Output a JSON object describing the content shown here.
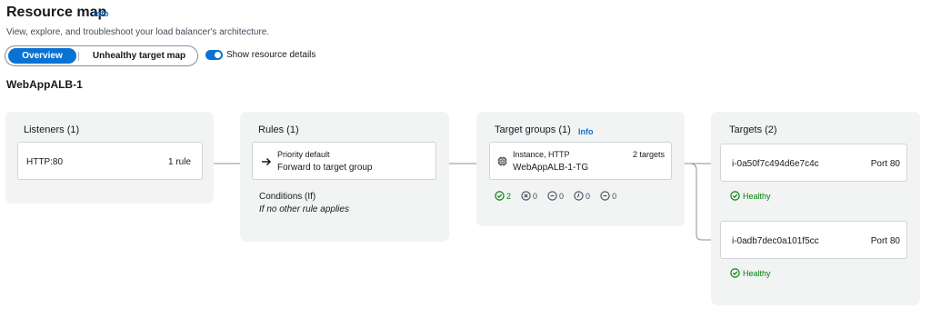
{
  "header": {
    "title": "Resource map",
    "info": "Info",
    "description": "View, explore, and troubleshoot your load balancer's architecture."
  },
  "tabs": {
    "overview": "Overview",
    "unhealthy": "Unhealthy target map"
  },
  "toggle": {
    "label": "Show resource details",
    "on": true
  },
  "load_balancer": {
    "name": "WebAppALB-1"
  },
  "listeners": {
    "title": "Listeners (1)",
    "item": {
      "name": "HTTP:80",
      "rules": "1 rule"
    }
  },
  "rules": {
    "title": "Rules (1)",
    "item": {
      "priority": "Priority default",
      "action": "Forward to target group"
    },
    "conditions_label": "Conditions (If)",
    "conditions_value": "If no other rule applies"
  },
  "target_groups": {
    "title": "Target groups (1)",
    "info": "Info",
    "item": {
      "type": "Instance, HTTP",
      "name": "WebAppALB-1-TG",
      "count": "2 targets"
    },
    "status": {
      "healthy": "2",
      "unhealthy": "0",
      "unused": "0",
      "draining": "0",
      "unavailable": "0"
    }
  },
  "targets": {
    "title": "Targets (2)",
    "items": [
      {
        "id": "i-0a50f7c494d6e7c4c",
        "port": "Port 80",
        "health": "Healthy"
      },
      {
        "id": "i-0adb7dec0a101f5cc",
        "port": "Port 80",
        "health": "Healthy"
      }
    ]
  },
  "colors": {
    "accent": "#0972d3",
    "healthy": "#037f0c",
    "panel_bg": "#f2f3f3"
  },
  "icons": {
    "arrow": "arrow-right-icon",
    "chip": "instance-chip-icon",
    "check": "check-circle-icon",
    "x": "x-circle-icon",
    "minus": "minus-circle-icon",
    "clock": "clock-circle-icon"
  }
}
